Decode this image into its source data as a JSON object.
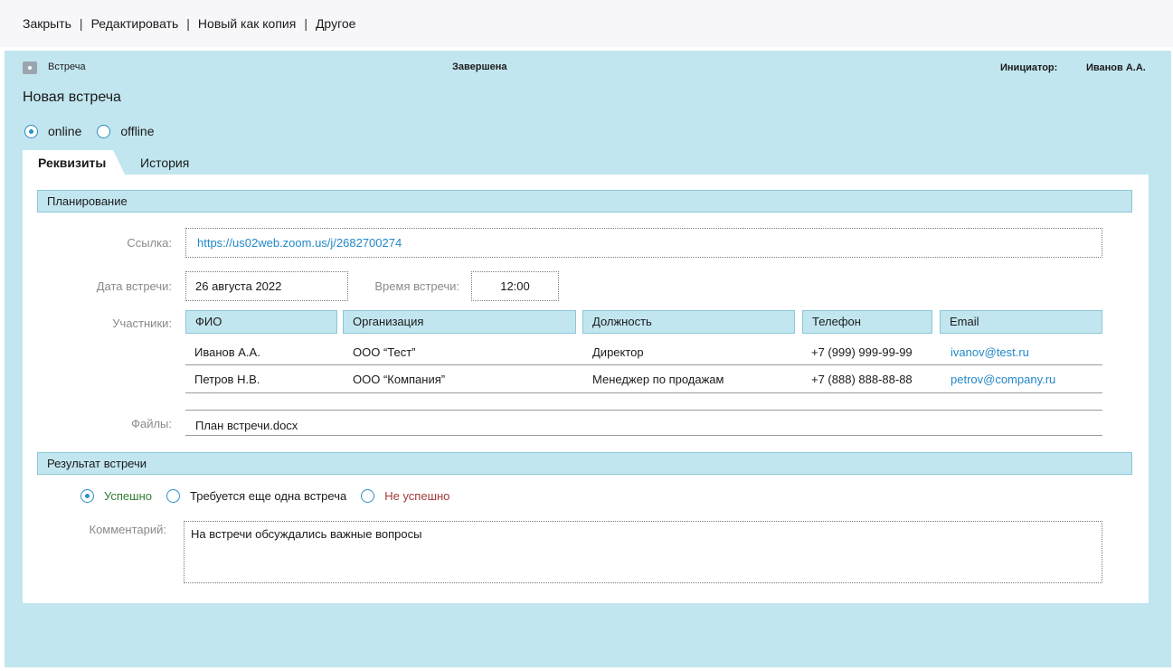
{
  "toolbar": {
    "close": "Закрыть",
    "edit": "Редактировать",
    "new_copy": "Новый как копия",
    "other": "Другое",
    "separator": "|"
  },
  "header": {
    "doc_type": "Встреча",
    "status": "Завершена",
    "initiator_label": "Инициатор:",
    "initiator_name": "Иванов А.А."
  },
  "title": "Новая встреча",
  "mode": {
    "online": "online",
    "offline": "offline",
    "selected": "online"
  },
  "tabs": [
    {
      "label": "Реквизиты",
      "active": true
    },
    {
      "label": "История",
      "active": false
    }
  ],
  "planning": {
    "section_title": "Планирование",
    "link_label": "Ссылка:",
    "link_value": "https://us02web.zoom.us/j/2682700274",
    "date_label": "Дата встречи:",
    "date_value": "26 августа 2022",
    "time_label": "Время встречи:",
    "time_value": "12:00",
    "participants_label": "Участники:",
    "columns": [
      "ФИО",
      "Организация",
      "Должность",
      "Телефон",
      "Email"
    ],
    "rows": [
      [
        "Иванов А.А.",
        "ООО “Тест”",
        "Директор",
        "+7 (999) 999-99-99",
        "ivanov@test.ru"
      ],
      [
        "Петров Н.В.",
        "ООО “Компания”",
        "Менеджер по продажам",
        "+7 (888) 888-88-88",
        "petrov@company.ru"
      ]
    ],
    "files_label": "Файлы:",
    "file_name": "План встречи.docx"
  },
  "result": {
    "section_title": "Результат встречи",
    "option_success": "Успешно",
    "option_another": "Требуется еще одна встреча",
    "option_fail": "Не успешно",
    "selected": "Успешно",
    "comment_label": "Комментарий:",
    "comment_value": "На встречи обсуждались важные вопросы"
  },
  "colors": {
    "accent": "#2b8fc4",
    "panel_bg": "#c2e6ef",
    "link": "#2288c9",
    "success": "#2e7d32",
    "fail": "#a33a3a"
  }
}
